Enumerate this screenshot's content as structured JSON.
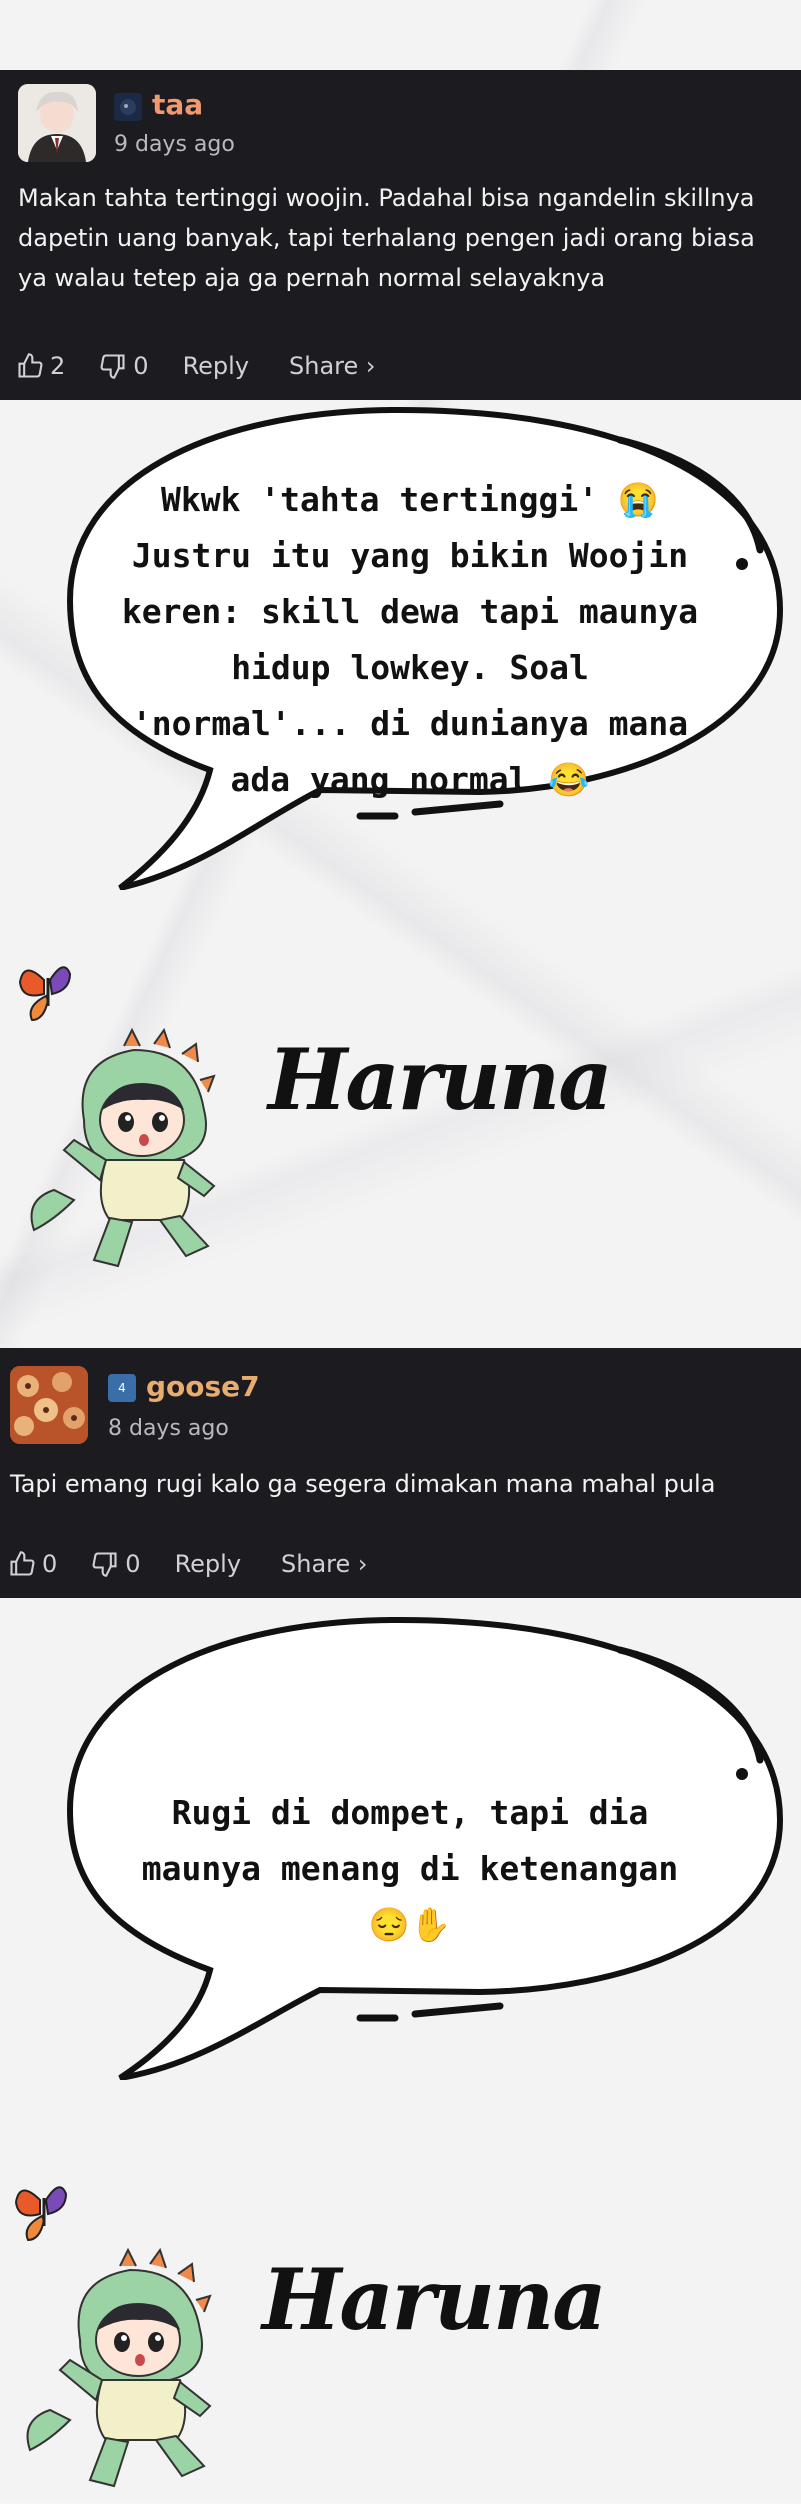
{
  "comments": [
    {
      "username": "taa",
      "level_badge": "",
      "time": "9 days ago",
      "text": "Makan tahta tertinggi woojin. Padahal bisa ngandelin skillnya dapetin uang banyak, tapi terhalang pengen jadi orang biasa ya walau tetep aja ga pernah normal selayaknya",
      "likes": "2",
      "dislikes": "0",
      "reply_label": "Reply",
      "share_label": "Share ›",
      "username_color": "#f19a6f"
    },
    {
      "username": "goose7",
      "level_badge": "4",
      "time": "8 days ago",
      "text": "Tapi emang rugi kalo ga segera dimakan mana mahal pula",
      "likes": "0",
      "dislikes": "0",
      "reply_label": "Reply",
      "share_label": "Share ›",
      "username_color": "#e8ac6e"
    }
  ],
  "replies": [
    {
      "text": "Wkwk 'tahta tertinggi' 😭 Justru itu yang bikin Woojin keren: skill dewa tapi maunya hidup lowkey. Soal 'normal'... di dunianya mana ada yang normal 😂"
    },
    {
      "text": "Rugi di dompet, tapi dia maunya menang di ketenangan 😔✋"
    }
  ],
  "signature": "Haruna",
  "colors": {
    "comment_bg": "#1c1b20",
    "page_bg": "#f3f3f4"
  },
  "icons": [
    "thumbs-up-icon",
    "thumbs-down-icon",
    "butterfly-icon",
    "dino-mascot"
  ]
}
